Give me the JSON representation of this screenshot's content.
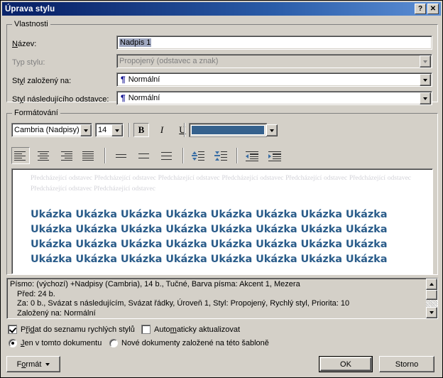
{
  "window": {
    "title": "Úprava stylu",
    "help_button": "?",
    "close_button": "✕"
  },
  "properties": {
    "group_label": "Vlastnosti",
    "name_label": "Název:",
    "name_value": "Nadpis 1",
    "style_type_label": "Typ stylu:",
    "style_type_value": "Propojený (odstavec a znak)",
    "based_on_label": "Styl založený na:",
    "based_on_value": "Normální",
    "next_style_label": "Styl následujícího odstavce:",
    "next_style_value": "Normální",
    "pilcrow_glyph": "¶"
  },
  "formatting": {
    "group_label": "Formátování",
    "font_family": "Cambria (Nadpisy)",
    "font_size": "14",
    "bold_label": "B",
    "italic_label": "I",
    "underline_label": "U",
    "font_color_hex": "#35618d",
    "bold_active": true,
    "italic_active": false,
    "underline_active": false,
    "align_active": "left",
    "toolbar_icons": [
      "align-left-icon",
      "align-center-icon",
      "align-right-icon",
      "align-justify-icon",
      "line-spacing-single-icon",
      "line-spacing-1-5-icon",
      "line-spacing-double-icon",
      "space-before-icon",
      "space-after-icon",
      "decrease-indent-icon",
      "increase-indent-icon"
    ]
  },
  "preview": {
    "preceding_paragraph": "Předcházející odstavec Předcházející odstavec Předcházející odstavec Předcházející odstavec Předcházející odstavec Předcházející odstavec Předcházející odstavec Předcházející odstavec",
    "sample_line": "Ukázka Ukázka Ukázka Ukázka Ukázka Ukázka Ukázka Ukázka",
    "sample_color_hex": "#2a5c8a",
    "preceding_color_hex": "#d2d2d8"
  },
  "description": {
    "line1": "Písmo: (výchozí) +Nadpisy (Cambria), 14 b., Tučné, Barva písma: Akcent 1, Mezera",
    "line2": "Před:  24 b.",
    "line3": "Za:  0 b., Svázat s následujícím, Svázat řádky, Úroveň 1, Styl: Propojený, Rychlý styl, Priorita: 10",
    "line4": "Založený na: Normální"
  },
  "options": {
    "add_to_quick_styles_label": "Přidat do seznamu rychlých stylů",
    "add_to_quick_styles_checked": true,
    "auto_update_label": "Automaticky aktualizovat",
    "auto_update_checked": false,
    "only_this_document_label": "Jen v tomto dokumentu",
    "only_this_document_selected": true,
    "new_documents_label": "Nové dokumenty založené na této šabloně",
    "new_documents_selected": false
  },
  "buttons": {
    "format": "Formát",
    "ok": "OK",
    "cancel": "Storno"
  }
}
